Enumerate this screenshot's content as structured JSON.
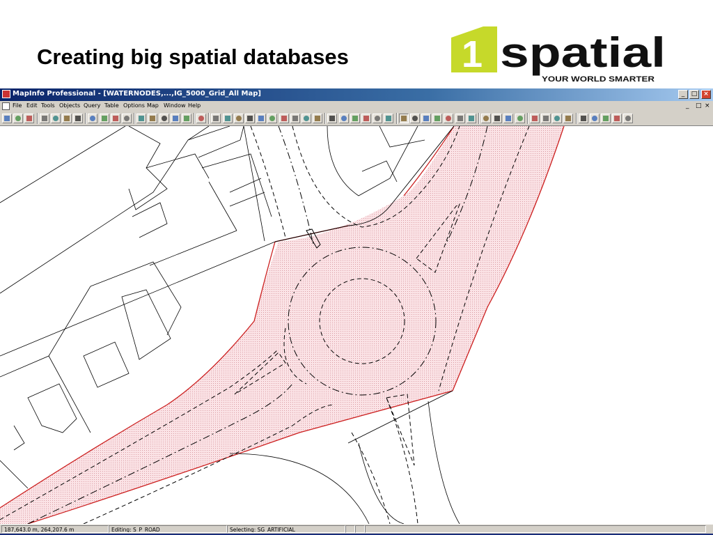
{
  "slide": {
    "title": "Creating big spatial databases"
  },
  "logo": {
    "digit": "1",
    "wordmark": "spatial",
    "tagline": "YOUR WORLD SMARTER",
    "colors": {
      "accent": "#c6d92a",
      "text": "#111111"
    }
  },
  "app": {
    "window_title": "MapInfo Professional - [WATERNODES,...,IG_5000_Grid_All Map]",
    "window_buttons": [
      "_",
      "□",
      "×"
    ],
    "menu": [
      "File",
      "Edit",
      "Tools",
      "Objects",
      "Query",
      "Table",
      "Options",
      "Map",
      "Window",
      "Help"
    ],
    "mdi_buttons": [
      "_",
      "□",
      "×"
    ]
  },
  "toolbar": {
    "icons": [
      "new-icon",
      "open-icon",
      "open-workspace-icon",
      "save-icon",
      "save-workspace-icon",
      "save-window-icon",
      "print-icon",
      "cut-icon",
      "copy-icon",
      "paste-icon",
      "undo-icon",
      "new-browser-icon",
      "new-mapper-icon",
      "new-grapher-icon",
      "new-layout-icon",
      "new-redistrict-icon",
      "help-pointer-icon",
      "symbol-icon",
      "line-icon",
      "polyline-icon",
      "arc-icon",
      "polygon-icon",
      "ellipse-icon",
      "rectangle-icon",
      "rounded-rect-icon",
      "text-icon",
      "frame-icon",
      "reshape-icon",
      "add-node-icon",
      "symbol-style-icon",
      "line-style-icon",
      "region-style-icon",
      "text-style-icon",
      "select-icon",
      "marquee-select-icon",
      "radius-select-icon",
      "polygon-select-icon",
      "boundary-select-icon",
      "unselect-icon",
      "invert-select-icon",
      "zoom-in-icon",
      "zoom-out-icon",
      "change-view-icon",
      "grabber-icon",
      "info-icon",
      "label-icon",
      "drag-window-icon",
      "ruler-icon",
      "layer-control-icon",
      "legend-icon",
      "statistics-icon",
      "hotlink-icon",
      "window-icon"
    ]
  },
  "status": {
    "coords": "187,643.0 m, 264,207.6 m",
    "editing": "Editing: S_P_ROAD",
    "selecting": "Selecting: SG_ARTIFICIAL"
  },
  "map": {
    "colors": {
      "road_fill": "#f3c6cc",
      "road_edge": "#cc1f1f",
      "parcel": "#000000"
    },
    "layers": [
      "S_P_ROAD",
      "SG_ARTIFICIAL"
    ]
  }
}
